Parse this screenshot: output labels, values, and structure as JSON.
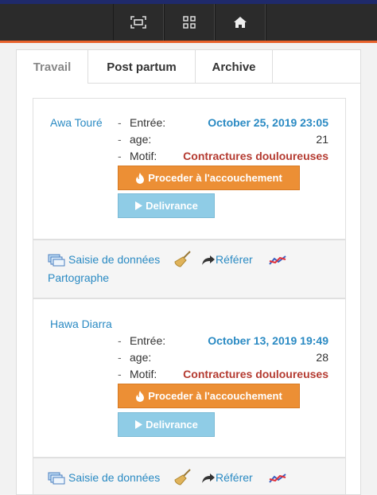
{
  "tabs": [
    "Travail",
    "Post partum",
    "Archive"
  ],
  "labels": {
    "entree": "Entrée:",
    "age": "age:",
    "motif": "Motif:"
  },
  "buttons": {
    "accouchement": "Proceder à l'accouchement",
    "delivrance": "Delivrance"
  },
  "actions": {
    "saisie": "Saisie de données",
    "referer": "Référer",
    "partographe": "Partographe"
  },
  "patients": [
    {
      "name": "Awa Touré",
      "entree": "October 25, 2019 23:05",
      "age": "21",
      "motif": "Contractures douloureuses"
    },
    {
      "name": "Hawa Diarra",
      "entree": "October 13, 2019 19:49",
      "age": "28",
      "motif": "Contractures douloureuses"
    }
  ],
  "icons": [
    "fullscreen-icon",
    "grid-icon",
    "home-icon",
    "fire-icon",
    "play-icon",
    "data-entry-icon",
    "broom-icon",
    "share-arrow-icon",
    "line-chart-icon"
  ],
  "colors": {
    "accent": "#e8622c",
    "link": "#2a8ac3",
    "danger": "#b43a30",
    "orange_button": "#ec8f35",
    "blue_button": "#8fcce6"
  }
}
